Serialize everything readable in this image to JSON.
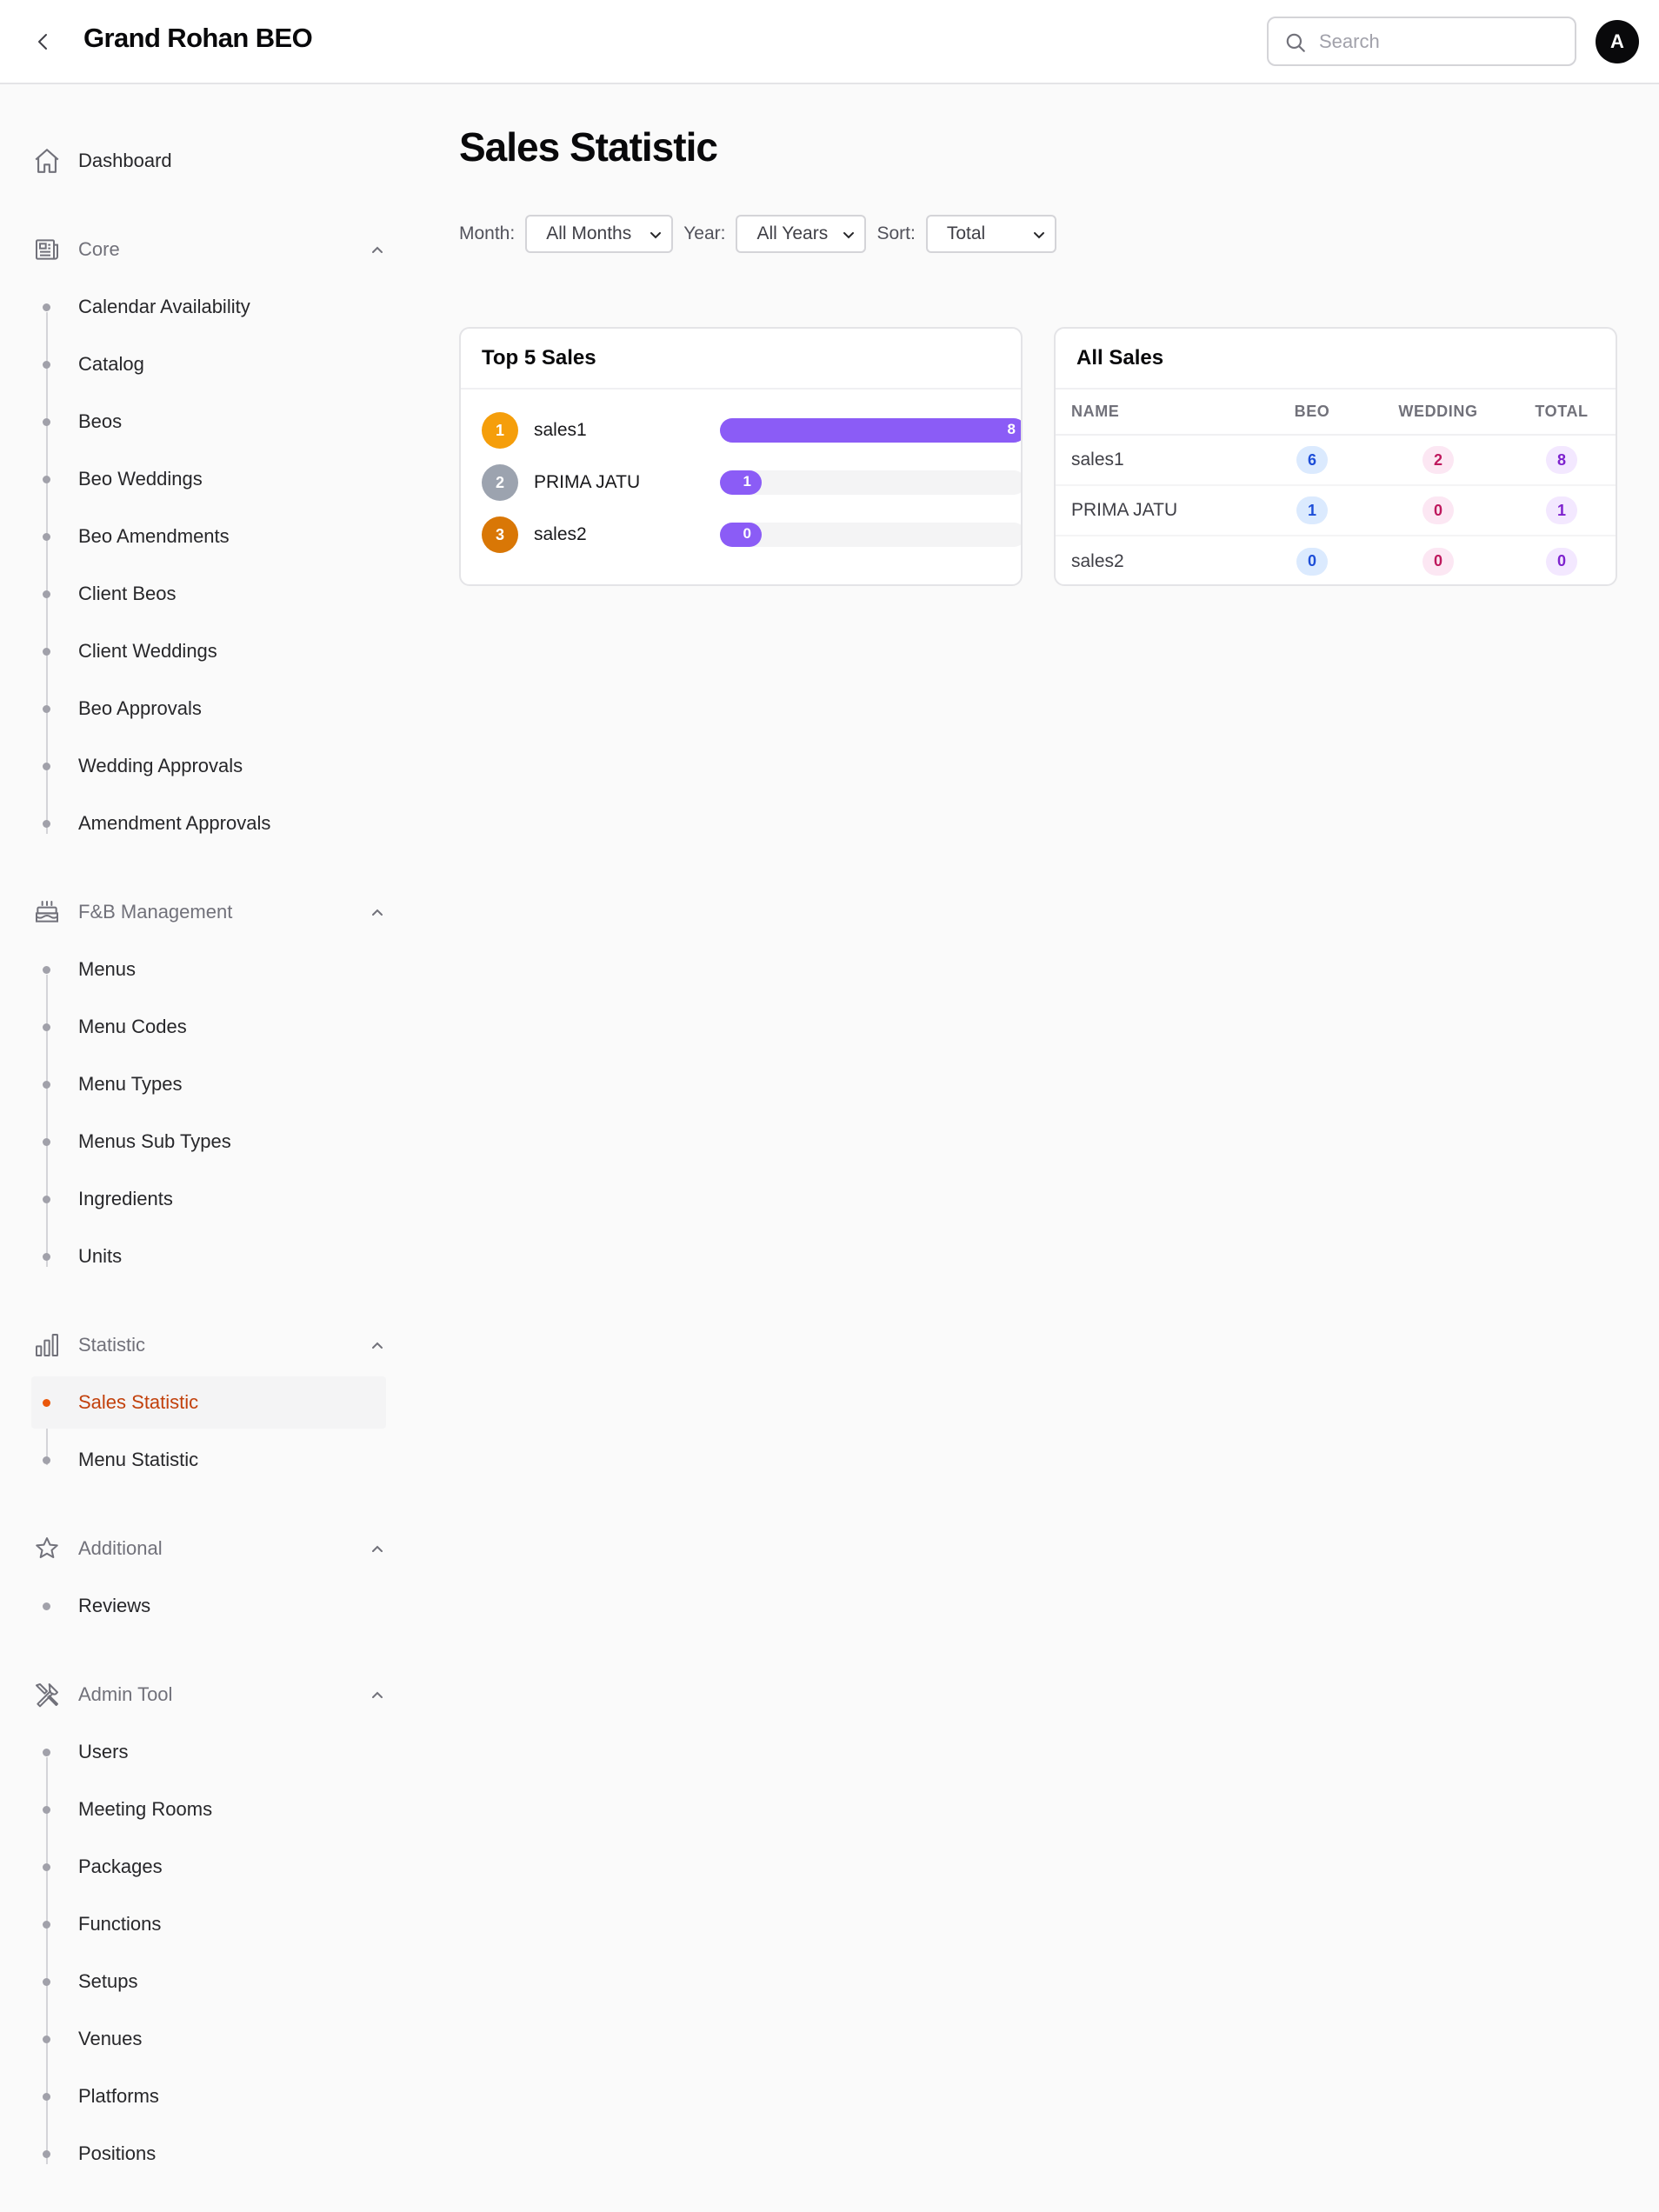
{
  "header": {
    "title": "Grand Rohan BEO",
    "search_placeholder": "Search",
    "avatar_initial": "A"
  },
  "sidebar": {
    "dashboard": "Dashboard",
    "groups": [
      {
        "label": "Core",
        "icon": "newspaper-icon",
        "items": [
          "Calendar Availability",
          "Catalog",
          "Beos",
          "Beo Weddings",
          "Beo Amendments",
          "Client Beos",
          "Client Weddings",
          "Beo Approvals",
          "Wedding Approvals",
          "Amendment Approvals"
        ]
      },
      {
        "label": "F&B Management",
        "icon": "cake-icon",
        "items": [
          "Menus",
          "Menu Codes",
          "Menu Types",
          "Menus Sub Types",
          "Ingredients",
          "Units"
        ]
      },
      {
        "label": "Statistic",
        "icon": "bar-chart-icon",
        "items": [
          "Sales Statistic",
          "Menu Statistic"
        ],
        "active": "Sales Statistic"
      },
      {
        "label": "Additional",
        "icon": "star-icon",
        "items": [
          "Reviews"
        ]
      },
      {
        "label": "Admin Tool",
        "icon": "tools-icon",
        "items": [
          "Users",
          "Meeting Rooms",
          "Packages",
          "Functions",
          "Setups",
          "Venues",
          "Platforms",
          "Positions"
        ]
      }
    ]
  },
  "main": {
    "title": "Sales Statistic",
    "filters": {
      "month_label": "Month:",
      "month_value": "All Months",
      "year_label": "Year:",
      "year_value": "All Years",
      "sort_label": "Sort:",
      "sort_value": "Total"
    },
    "top_sales": {
      "title": "Top 5 Sales",
      "max": 8,
      "rows": [
        {
          "rank": "1",
          "name": "sales1",
          "value": 8,
          "badge_color": "#f59e0b"
        },
        {
          "rank": "2",
          "name": "PRIMA JATU",
          "value": 1,
          "badge_color": "#9ca3af"
        },
        {
          "rank": "3",
          "name": "sales2",
          "value": 0,
          "badge_color": "#d97706"
        }
      ]
    },
    "all_sales": {
      "title": "All Sales",
      "columns": [
        "NAME",
        "BEO",
        "WEDDING",
        "TOTAL"
      ],
      "rows": [
        {
          "name": "sales1",
          "beo": "6",
          "wedding": "2",
          "total": "8"
        },
        {
          "name": "PRIMA JATU",
          "beo": "1",
          "wedding": "0",
          "total": "1"
        },
        {
          "name": "sales2",
          "beo": "0",
          "wedding": "0",
          "total": "0"
        }
      ]
    }
  }
}
